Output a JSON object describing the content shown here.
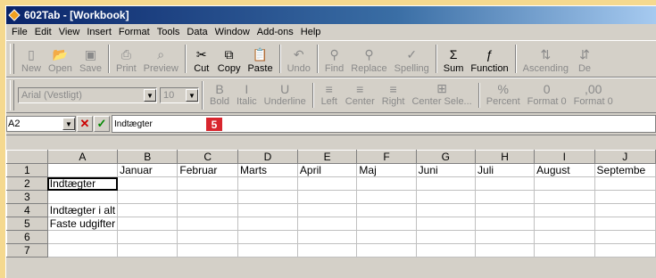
{
  "window": {
    "title": "602Tab - [Workbook]"
  },
  "menu": [
    "File",
    "Edit",
    "View",
    "Insert",
    "Format",
    "Tools",
    "Data",
    "Window",
    "Add-ons",
    "Help"
  ],
  "toolbar": [
    {
      "label": "New",
      "icon": "new-icon",
      "enabled": false
    },
    {
      "label": "Open",
      "icon": "open-icon",
      "enabled": false
    },
    {
      "label": "Save",
      "icon": "save-icon",
      "enabled": false
    },
    {
      "label": "Print",
      "icon": "print-icon",
      "enabled": false
    },
    {
      "label": "Preview",
      "icon": "preview-icon",
      "enabled": false
    },
    {
      "label": "Cut",
      "icon": "cut-icon",
      "enabled": true
    },
    {
      "label": "Copy",
      "icon": "copy-icon",
      "enabled": true
    },
    {
      "label": "Paste",
      "icon": "paste-icon",
      "enabled": true
    },
    {
      "label": "Undo",
      "icon": "undo-icon",
      "enabled": false
    },
    {
      "label": "Find",
      "icon": "find-icon",
      "enabled": false
    },
    {
      "label": "Replace",
      "icon": "replace-icon",
      "enabled": false
    },
    {
      "label": "Spelling",
      "icon": "spelling-icon",
      "enabled": false
    },
    {
      "label": "Sum",
      "icon": "sum-icon",
      "enabled": true
    },
    {
      "label": "Function",
      "icon": "function-icon",
      "enabled": true
    },
    {
      "label": "Ascending",
      "icon": "sort-ascending-icon",
      "enabled": false
    },
    {
      "label": "De",
      "icon": "sort-descending-icon",
      "enabled": false
    }
  ],
  "format_bar": {
    "font": "Arial (Vestligt)",
    "size": "10",
    "buttons": [
      "Bold",
      "Italic",
      "Underline",
      "Left",
      "Center",
      "Right",
      "Center Sele...",
      "Percent",
      "Format 0",
      "Format 0"
    ]
  },
  "formula_bar": {
    "cell_ref": "A2",
    "content": "Indtægter",
    "badge": "5"
  },
  "sheet": {
    "columns": [
      "A",
      "B",
      "C",
      "D",
      "E",
      "F",
      "G",
      "H",
      "I",
      "J"
    ],
    "rows": [
      {
        "n": "1",
        "cells": [
          "",
          "Januar",
          "Februar",
          "Marts",
          "April",
          "Maj",
          "Juni",
          "Juli",
          "August",
          "Septembe"
        ]
      },
      {
        "n": "2",
        "cells": [
          "Indtægter",
          "",
          "",
          "",
          "",
          "",
          "",
          "",
          "",
          ""
        ]
      },
      {
        "n": "3",
        "cells": [
          "",
          "",
          "",
          "",
          "",
          "",
          "",
          "",
          "",
          ""
        ]
      },
      {
        "n": "4",
        "cells": [
          "Indtægter i alt",
          "",
          "",
          "",
          "",
          "",
          "",
          "",
          "",
          ""
        ]
      },
      {
        "n": "5",
        "cells": [
          "Faste udgifter",
          "",
          "",
          "",
          "",
          "",
          "",
          "",
          "",
          ""
        ]
      },
      {
        "n": "6",
        "cells": [
          "",
          "",
          "",
          "",
          "",
          "",
          "",
          "",
          "",
          ""
        ]
      },
      {
        "n": "7",
        "cells": [
          "",
          "",
          "",
          "",
          "",
          "",
          "",
          "",
          "",
          ""
        ]
      }
    ]
  },
  "colors": {
    "background": "#f5d98f",
    "titlebar": "#0a246a",
    "badge": "#d8262e"
  }
}
